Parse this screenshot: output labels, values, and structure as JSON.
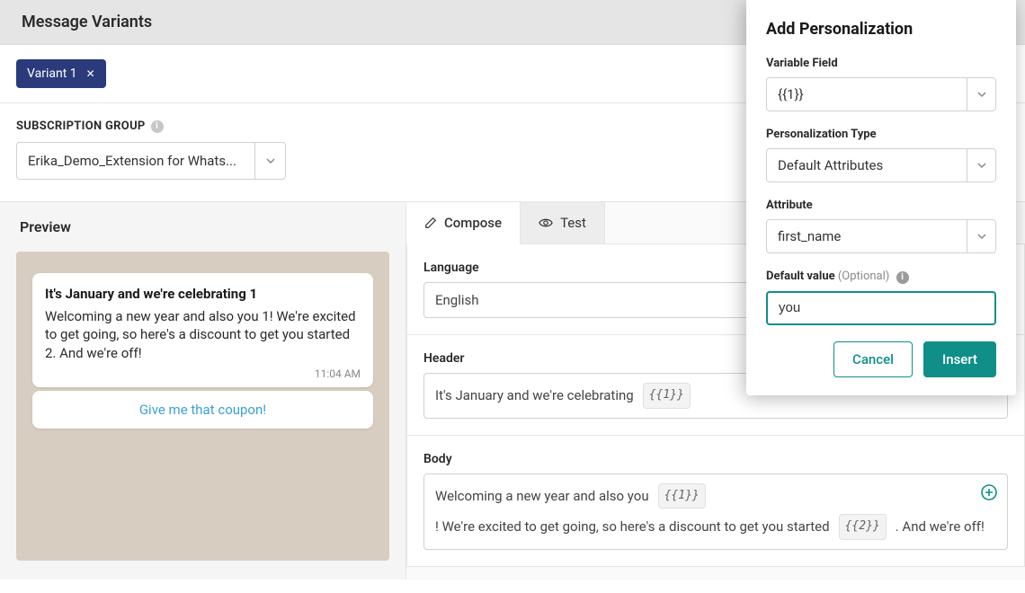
{
  "header": {
    "title": "Message Variants"
  },
  "variant": {
    "label": "Variant 1"
  },
  "subscription": {
    "label": "SUBSCRIPTION GROUP",
    "value": "Erika_Demo_Extension for Whats..."
  },
  "preview": {
    "title": "Preview",
    "bubble": {
      "title": "It's January and we're celebrating 1",
      "body": "Welcoming a new year and also you 1! We're excited to get going, so here's a discount to get you started 2. And we're off!",
      "time": "11:04 AM",
      "button": "Give me that coupon!"
    }
  },
  "compose": {
    "tabs": {
      "compose": "Compose",
      "test": "Test"
    },
    "language": {
      "label": "Language",
      "value": "English"
    },
    "header_field": {
      "label": "Header",
      "text": "It's January and we're celebrating",
      "chip1": "{{1}}"
    },
    "body_field": {
      "label": "Body",
      "text_a": "Welcoming a new year and also you",
      "chip1": "{{1}}",
      "text_b": "! We're excited to get going, so here's a discount to get you started",
      "chip2": "{{2}}",
      "text_c": ". And we're off!"
    }
  },
  "panel": {
    "title": "Add Personalization",
    "variable_field": {
      "label": "Variable Field",
      "value": "{{1}}"
    },
    "personalization_type": {
      "label": "Personalization Type",
      "value": "Default Attributes"
    },
    "attribute": {
      "label": "Attribute",
      "value": "first_name"
    },
    "default_value": {
      "label": "Default value",
      "optional": "(Optional)",
      "value": "you"
    },
    "actions": {
      "cancel": "Cancel",
      "insert": "Insert"
    }
  }
}
